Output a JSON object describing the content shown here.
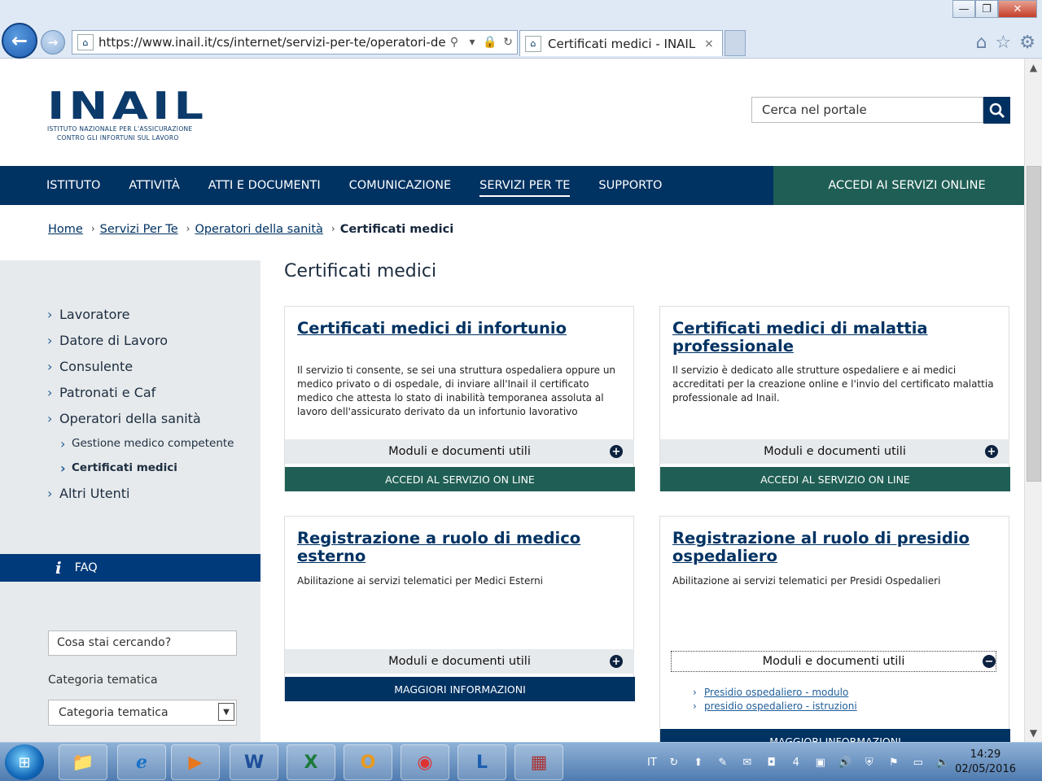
{
  "browser": {
    "url": "https://www.inail.it/cs/internet/servizi-per-te/operatori-della-",
    "tab_title": "Certificati medici - INAIL",
    "tab_close": "×",
    "win_min": "—",
    "win_max": "❐",
    "win_close": "✕",
    "back_glyph": "←",
    "fwd_glyph": "→",
    "home_glyph": "⌂",
    "star_glyph": "☆",
    "gear_glyph": "⚙",
    "search_glyph": "⚲",
    "lock_glyph": "🔒",
    "refresh_glyph": "↻",
    "dropdown_glyph": "▾"
  },
  "header": {
    "logo_text": "INAIL",
    "logo_sub_1": "ISTITUTO NAZIONALE PER L'ASSICURAZIONE",
    "logo_sub_2": "CONTRO GLI INFORTUNI SUL LAVORO",
    "search_value": "Cerca nel portale"
  },
  "nav": {
    "items": [
      "ISTITUTO",
      "ATTIVITÀ",
      "ATTI E DOCUMENTI",
      "COMUNICAZIONE",
      "SERVIZI PER TE",
      "SUPPORTO"
    ],
    "active_index": 4,
    "accedi": "ACCEDI AI SERVIZI ONLINE"
  },
  "breadcrumb": {
    "items": [
      "Home",
      "Servizi Per Te",
      "Operatori della sanità"
    ],
    "current": "Certificati medici",
    "sep": "›"
  },
  "sidebar": {
    "items": [
      "Lavoratore",
      "Datore di Lavoro",
      "Consulente",
      "Patronati e Caf",
      "Operatori della sanità"
    ],
    "subitems": [
      "Gestione medico competente",
      "Certificati medici"
    ],
    "last_item": "Altri Utenti",
    "faq_icon": "i",
    "faq": "FAQ",
    "search_value": "Cosa stai cercando?",
    "category_label": "Categoria tematica",
    "category_value": "Categoria tematica",
    "select_arrow": "▼"
  },
  "main": {
    "title": "Certificati medici",
    "modules_label": "Moduli e documenti utili",
    "plus": "+",
    "minus": "−",
    "cards": [
      {
        "title": "Certificati medici di infortunio",
        "text": "Il servizio ti consente, se sei una struttura ospedaliera oppure un medico privato o di ospedale, di inviare all'Inail il certificato medico che attesta lo stato di inabilità temporanea assoluta al lavoro dell'assicurato derivato da un infortunio lavorativo",
        "cta": "ACCEDI AL SERVIZIO ON LINE"
      },
      {
        "title": "Certificati medici di malattia professionale",
        "text": "Il servizio è dedicato alle strutture ospedaliere e ai medici accreditati per la creazione online e l'invio del certificato malattia professionale ad Inail.",
        "cta": "ACCEDI AL SERVIZIO ON LINE"
      },
      {
        "title": "Registrazione a ruolo di medico esterno",
        "text": "Abilitazione ai servizi telematici per Medici Esterni",
        "cta": "MAGGIORI INFORMAZIONI"
      },
      {
        "title": "Registrazione al ruolo di presidio ospedaliero",
        "text": "Abilitazione ai servizi telematici per Presidi Ospedalieri",
        "cta": "MAGGIORI INFORMAZIONI",
        "links": [
          "Presidio ospedaliero - modulo",
          "presidio ospedaliero - istruzioni"
        ]
      }
    ]
  },
  "taskbar": {
    "start_glyph": "⊞",
    "apps": [
      "📁",
      "e",
      "▶",
      "W",
      "X",
      "O",
      "◉",
      "L",
      "▦"
    ],
    "lang": "IT",
    "tray_icons": [
      "↻",
      "⬆",
      "✎",
      "✉",
      "◘",
      "4",
      "▣",
      "🔊",
      "⛨",
      "⚑",
      "▭",
      "🔈"
    ],
    "time": "14:29",
    "date": "02/05/2016"
  },
  "colors": {
    "brand_navy": "#003262",
    "accent_green": "#1f5e55",
    "sidebar_gray": "#e7eaec"
  }
}
